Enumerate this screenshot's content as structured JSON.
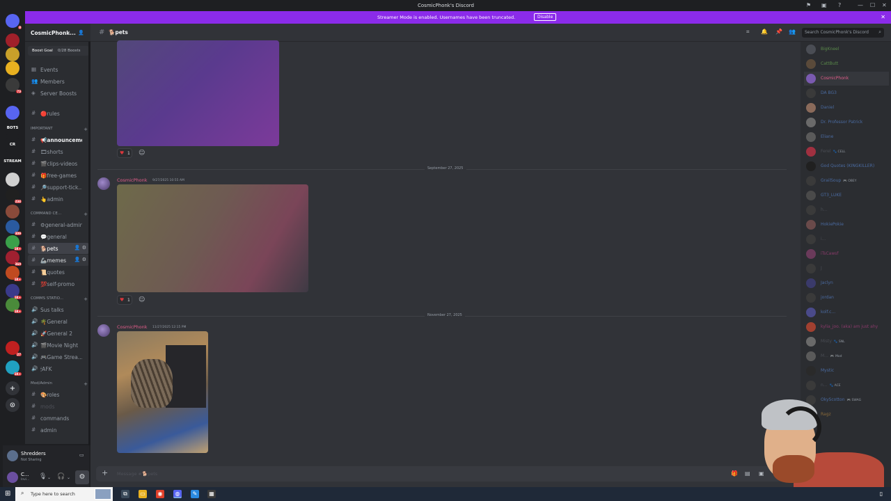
{
  "window": {
    "title": "CosmicPhonk's Discord",
    "controls": [
      "⚑",
      "▣",
      "◉",
      "?",
      "—",
      "☐",
      "✕"
    ]
  },
  "banner": {
    "message": "Streamer Mode is enabled. Usernames have been truncated.",
    "action": "Disable",
    "color": "#8b2bea"
  },
  "guilds": [
    {
      "label": "",
      "color": "#5865f2",
      "badge": "8"
    },
    {
      "label": "",
      "color": "#a0202a",
      "badge": ""
    },
    {
      "label": "",
      "color": "#c8a02a",
      "badge": ""
    },
    {
      "label": "",
      "color": "#e8b020",
      "badge": ""
    },
    {
      "label": "",
      "color": "#3a3a3a",
      "badge": "73"
    },
    {
      "label": "",
      "color": "#5865f2",
      "badge": ""
    },
    {
      "label": "BOTS",
      "color": "#1e1f22",
      "badge": ""
    },
    {
      "label": "CR",
      "color": "#1e1f22",
      "badge": ""
    },
    {
      "label": "STREAM",
      "color": "#1e1f22",
      "badge": ""
    },
    {
      "label": "",
      "color": "#d0d0d0",
      "badge": ""
    },
    {
      "label": "",
      "color": "#202020",
      "badge": "234"
    },
    {
      "label": "",
      "color": "#8a4a3a",
      "badge": ""
    },
    {
      "label": "",
      "color": "#2a5aa0",
      "badge": "309"
    },
    {
      "label": "",
      "color": "#3aa04a",
      "badge": "1K+"
    },
    {
      "label": "",
      "color": "#a02030",
      "badge": "360"
    },
    {
      "label": "",
      "color": "#c04a20",
      "badge": "1K+"
    },
    {
      "label": "",
      "color": "#3a3a8a",
      "badge": "1K+"
    },
    {
      "label": "",
      "color": "#4a8a3a",
      "badge": "1K+"
    },
    {
      "label": "",
      "color": "#c02020",
      "badge": "27"
    },
    {
      "label": "",
      "color": "#20a0c0",
      "badge": "1K+"
    }
  ],
  "guild_actions": {
    "add": "+",
    "discover": "⊙"
  },
  "server": {
    "name": "CosmicPhonk...",
    "boost_label": "Boost Goal",
    "boost_count": "0/28 Boosts",
    "nav": [
      {
        "icon": "▦",
        "label": "Events"
      },
      {
        "icon": "👥",
        "label": "Members"
      },
      {
        "icon": "◈",
        "label": "Server Boosts"
      }
    ]
  },
  "channels": {
    "rules": {
      "label": "🔴rules"
    },
    "cat_important": "IMPORTANT",
    "important": [
      {
        "label": "📢announceme...",
        "bold": true
      },
      {
        "label": "🎞shorts",
        "bold": false
      },
      {
        "label": "🎬clips-videos",
        "bold": false
      },
      {
        "label": "🎁free-games",
        "bold": false
      },
      {
        "label": "🔎support-tick...",
        "bold": false
      },
      {
        "label": "👆admin",
        "bold": false
      }
    ],
    "cat_command": "COMMAND CE...",
    "command": [
      {
        "label": "⚙general-admin",
        "state": ""
      },
      {
        "label": "💬general",
        "state": ""
      },
      {
        "label": "🐕pets",
        "state": "active"
      },
      {
        "label": "🦾memes",
        "state": "hover"
      },
      {
        "label": "📜quotes",
        "state": ""
      },
      {
        "label": "💯self-promo",
        "state": ""
      }
    ],
    "cat_comms": "COMMS STATIO...",
    "voice": [
      {
        "label": "Sus talks"
      },
      {
        "label": "🌴General"
      },
      {
        "label": "🚀General 2"
      },
      {
        "label": "🎬Movie Night"
      },
      {
        "label": "🎮Game Strea..."
      },
      {
        "label": "🕯AFK"
      }
    ],
    "cat_mod": "Mod/Admin",
    "mod": [
      {
        "label": "🎨roles",
        "dim": false
      },
      {
        "label": "mods",
        "dim": true
      },
      {
        "label": "commands",
        "dim": false
      },
      {
        "label": "admin",
        "dim": false
      }
    ]
  },
  "voice_status": {
    "name": "Shredders",
    "status": "Not Sharing"
  },
  "user": {
    "name": "C...",
    "status": "Invi..."
  },
  "chat": {
    "channel": "🐕pets",
    "search_placeholder": "Search CosmicPhonk's Discord",
    "composer_placeholder": "Message #🐕pets",
    "messages": [
      {
        "author": "",
        "timestamp": "",
        "reaction_count": "1",
        "date_divider": ""
      },
      {
        "author": "CosmicPhonk",
        "timestamp": "9/27/2025 10:55 AM",
        "reaction_count": "1",
        "date_divider": "September 27, 2025"
      },
      {
        "author": "CosmicPhonk",
        "timestamp": "11/27/2025 12:15 PM",
        "reaction_count": "",
        "date_divider": "November 27, 2025"
      }
    ]
  },
  "members": [
    {
      "name": "BigKneel",
      "tag": "",
      "color": "#5a8a4a",
      "av": "#4a4d54"
    },
    {
      "name": "CattButt",
      "tag": "",
      "color": "#5a8a4a",
      "av": "#5a4a3a"
    },
    {
      "name": "CosmicPhonk",
      "tag": "",
      "color": "#e25d8a",
      "av": "#7a5ab0"
    },
    {
      "name": "DA BG3",
      "tag": "",
      "color": "#4a6aa0",
      "av": "#3a3a3a"
    },
    {
      "name": "Daniel",
      "tag": "",
      "color": "#4a6aa0",
      "av": "#8a6a5a"
    },
    {
      "name": "Dr. Professor Patrick",
      "tag": "",
      "color": "#4a6aa0",
      "av": "#6a6a6a"
    },
    {
      "name": "Eliane",
      "tag": "",
      "color": "#4a6aa0",
      "av": "#5a5a5a"
    },
    {
      "name": "Ferel",
      "tag": "🐾 CELL",
      "color": "#4a4d54",
      "av": "#a03040"
    },
    {
      "name": "God Quotes (KINGKILLER)",
      "tag": "",
      "color": "#4a6aa0",
      "av": "#202020"
    },
    {
      "name": "GrailSoup",
      "tag": "🎮 OBEY",
      "color": "#4a6aa0",
      "av": "#3a3a3a"
    },
    {
      "name": "GT3_LUKE",
      "tag": "",
      "color": "#4a6aa0",
      "av": "#4a4a4a"
    },
    {
      "name": "h...",
      "tag": "",
      "color": "#4a4d54",
      "av": "#3a3a3a"
    },
    {
      "name": "HokiePokie",
      "tag": "",
      "color": "#4a6aa0",
      "av": "#6a4a4a"
    },
    {
      "name": "i...",
      "tag": "",
      "color": "#4a4d54",
      "av": "#3a3a3a"
    },
    {
      "name": "iTsCawsf",
      "tag": "",
      "color": "#8a3a6a",
      "av": "#6a3a5a"
    },
    {
      "name": "J",
      "tag": "",
      "color": "#4a4d54",
      "av": "#3a3a3a"
    },
    {
      "name": "Jaclyn",
      "tag": "",
      "color": "#4a6aa0",
      "av": "#3a3a6a"
    },
    {
      "name": "jordan",
      "tag": "",
      "color": "#4a6aa0",
      "av": "#3a3a3a"
    },
    {
      "name": "kolf.c...",
      "tag": "",
      "color": "#4a6aa0",
      "av": "#4a4a8a"
    },
    {
      "name": "kylia_joo. (aka) am just ahy",
      "tag": "",
      "color": "#8a3a6a",
      "av": "#a04030"
    },
    {
      "name": "Misty",
      "tag": "🐾 SNL",
      "color": "#4a4d54",
      "av": "#6a6a6a"
    },
    {
      "name": "M...",
      "tag": "🎮 Mod",
      "color": "#4a4d54",
      "av": "#5a5a5a"
    },
    {
      "name": "Mystic",
      "tag": "",
      "color": "#4a6aa0",
      "av": "#2a2a2a"
    },
    {
      "name": "n...",
      "tag": "🐾 ACE",
      "color": "#4a4d54",
      "av": "#3a3a3a"
    },
    {
      "name": "OkyScotton",
      "tag": "🎮 SWAG",
      "color": "#4a6aa0",
      "av": "#3a3a3a"
    },
    {
      "name": "Ragz",
      "tag": "",
      "color": "#8a6a3a",
      "av": "#3a3a3a"
    }
  ],
  "taskbar": {
    "search_placeholder": "Type here to search",
    "apps": [
      {
        "icon": "⧉",
        "color": "#3a4a5a"
      },
      {
        "icon": "▭",
        "color": "#e8b020"
      },
      {
        "icon": "◉",
        "color": "#e0402a"
      },
      {
        "icon": "◍",
        "color": "#5865f2"
      },
      {
        "icon": "✎",
        "color": "#2a8ae0"
      },
      {
        "icon": "▦",
        "color": "#3a3a3a"
      }
    ]
  }
}
